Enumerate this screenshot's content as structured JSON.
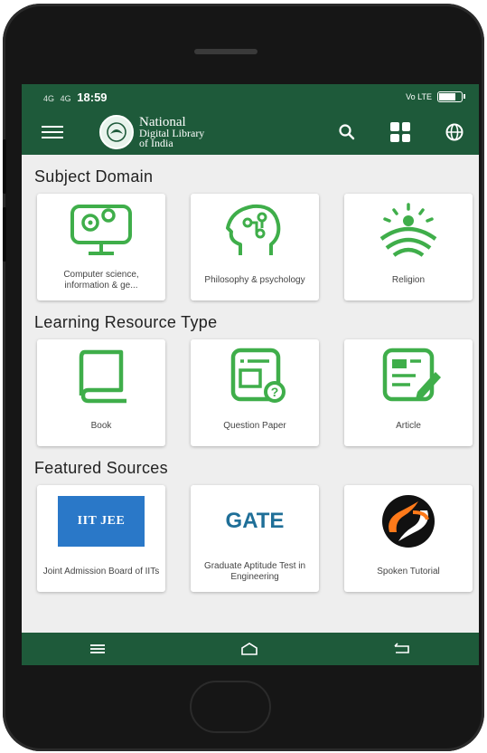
{
  "status_bar": {
    "network_left": "4G",
    "signal_text": "4G",
    "time": "18:59",
    "network_right": "Vo LTE",
    "battery_level": 0.75
  },
  "app_bar": {
    "logo_line1": "National",
    "logo_line2": "Digital Library",
    "logo_line3": "of India",
    "icons": [
      "menu-icon",
      "search-icon",
      "grid-icon",
      "globe-icon"
    ]
  },
  "colors": {
    "brand_green": "#1e5a3a",
    "icon_green": "#3fae4a",
    "gate_blue": "#1f6f98",
    "iit_blue": "#2a78c8"
  },
  "sections": [
    {
      "title": "Subject Domain",
      "items": [
        {
          "label": "Computer science, information & ge...",
          "icon": "computer-gears-icon"
        },
        {
          "label": "Philosophy & psychology",
          "icon": "head-circuit-icon"
        },
        {
          "label": "Religion",
          "icon": "sunrise-icon"
        }
      ]
    },
    {
      "title": "Learning Resource Type",
      "items": [
        {
          "label": "Book",
          "icon": "book-icon"
        },
        {
          "label": "Question Paper",
          "icon": "question-paper-icon"
        },
        {
          "label": "Article",
          "icon": "article-icon"
        }
      ]
    },
    {
      "title": "Featured Sources",
      "items": [
        {
          "label": "Joint Admission Board of IITs",
          "logo_text": "IIT JEE",
          "icon": "iit-jee-logo"
        },
        {
          "label": "Graduate Aptitude Test in Engineering",
          "logo_text": "GATE",
          "icon": "gate-logo"
        },
        {
          "label": "Spoken Tutorial",
          "icon": "spoken-tutorial-logo"
        }
      ]
    }
  ],
  "nav_bar": {
    "icons": [
      "recent-apps-icon",
      "home-icon",
      "back-icon"
    ]
  }
}
